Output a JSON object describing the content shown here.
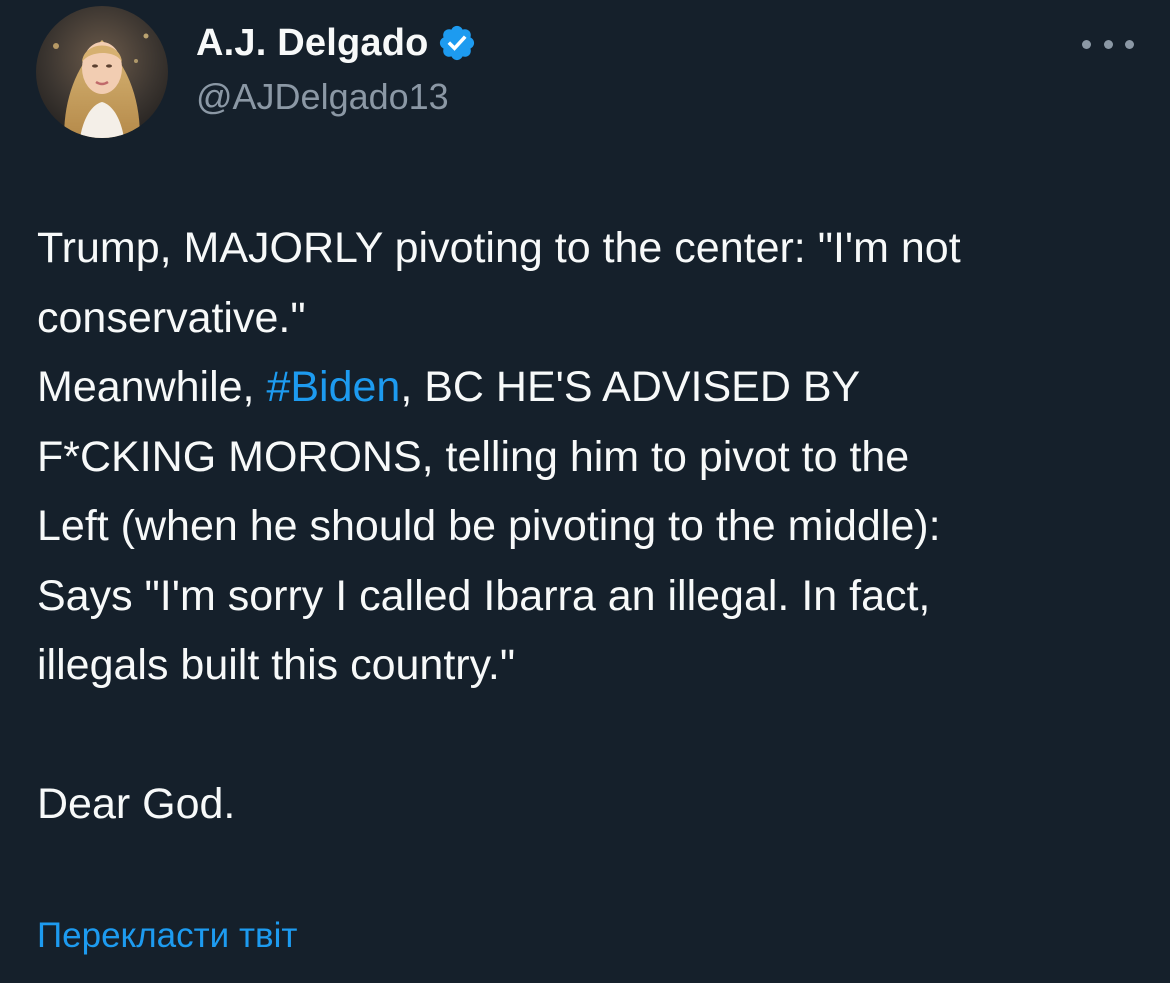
{
  "author": {
    "display_name": "A.J. Delgado",
    "handle": "@AJDelgado13",
    "verified": true,
    "avatar_icon": "profile-photo",
    "verified_icon": "verified-badge-icon"
  },
  "menu": {
    "icon": "more-horizontal-icon"
  },
  "tweet": {
    "lines": [
      "Trump, MAJORLY pivoting to the center: \"I'm not",
      "conservative.\"",
      "Meanwhile, ",
      "F*CKING MORONS, telling him to pivot to the",
      "Left (when he should be pivoting to the middle):",
      "Says \"I'm sorry I called Ibarra an illegal. In fact,",
      "illegals built this country.\"",
      "Dear God."
    ],
    "hashtag": "#Biden",
    "after_hashtag": ", BC HE'S ADVISED BY"
  },
  "translate_link": "Перекласти твіт",
  "colors": {
    "background": "#15202b",
    "text": "#f7f9f9",
    "secondary": "#8b98a5",
    "accent": "#1d9bf0"
  }
}
